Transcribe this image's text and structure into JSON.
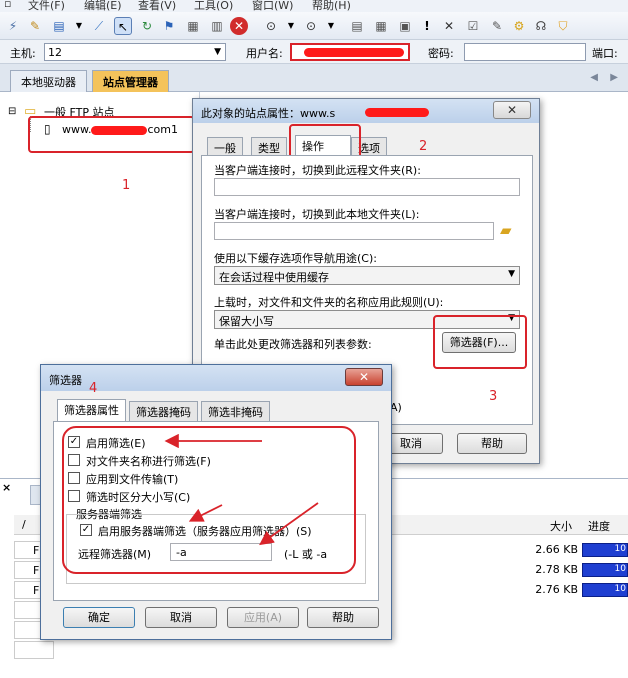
{
  "menu": {
    "file": "文件(F)",
    "edit": "编辑(E)",
    "view": "查看(V)",
    "tools": "工具(O)",
    "window": "窗口(W)",
    "help": "帮助(H)"
  },
  "addr": {
    "host_label": "主机:",
    "host_value": "12",
    "user_label": "用户名:",
    "pass_label": "密码:",
    "port_label": "端口:"
  },
  "panel_tabs": {
    "local": "本地驱动器",
    "site_manager": "站点管理器"
  },
  "tree": {
    "root": "一般 FTP 站点",
    "site_prefix": "www.",
    "site_suffix": "com1"
  },
  "annot": {
    "n1": "1",
    "n2": "2",
    "n3": "3",
    "n4": "4"
  },
  "props": {
    "title": "此对象的站点属性：www.s",
    "tabs": [
      "一般",
      "类型",
      "操作",
      "选项"
    ],
    "remote_folder_label": "当客户端连接时，切换到此远程文件夹(R):",
    "local_folder_label": "当客户端连接时，切换到此本地文件夹(L):",
    "cache_label": "使用以下缓存选项作导航用途(C):",
    "cache_value": "在会话过程中使用缓存",
    "case_label": "上载时，对文件和文件夹的名称应用此规则(U):",
    "case_value": "保留大小写",
    "filter_label": "单击此处更改筛选器和列表参数:",
    "filter_button": "筛选器(F)...",
    "partial_text": "A)",
    "cancel": "取消",
    "help": "帮助"
  },
  "filter": {
    "title": "筛选器",
    "tabs": [
      "筛选器属性",
      "筛选器掩码",
      "筛选非掩码"
    ],
    "enable": "启用筛选(E)",
    "folders": "对文件夹名称进行筛选(F)",
    "transfer": "应用到文件传输(T)",
    "case": "筛选时区分大小写(C)",
    "server_group": "服务器端筛选",
    "server_enable": "启用服务器端筛选（服务器应用筛选器）(S)",
    "remote_label": "远程筛选器(M)",
    "remote_value": "-a",
    "hint": "(-L 或 -a",
    "ok": "确定",
    "cancel": "取消",
    "apply": "应用(A)",
    "help": "帮助",
    "checked": {
      "enable": true,
      "folders": false,
      "transfer": false,
      "case": false,
      "server_enable": true
    }
  },
  "queue": {
    "close": "×",
    "col_size": "大小",
    "col_progress": "进度",
    "slash": "/",
    "rows": [
      {
        "mark": "F",
        "size": "2.66 KB",
        "progress": "10"
      },
      {
        "mark": "F",
        "size": "2.78 KB",
        "progress": "10"
      },
      {
        "mark": "F",
        "size": "2.76 KB",
        "progress": "10"
      }
    ]
  }
}
